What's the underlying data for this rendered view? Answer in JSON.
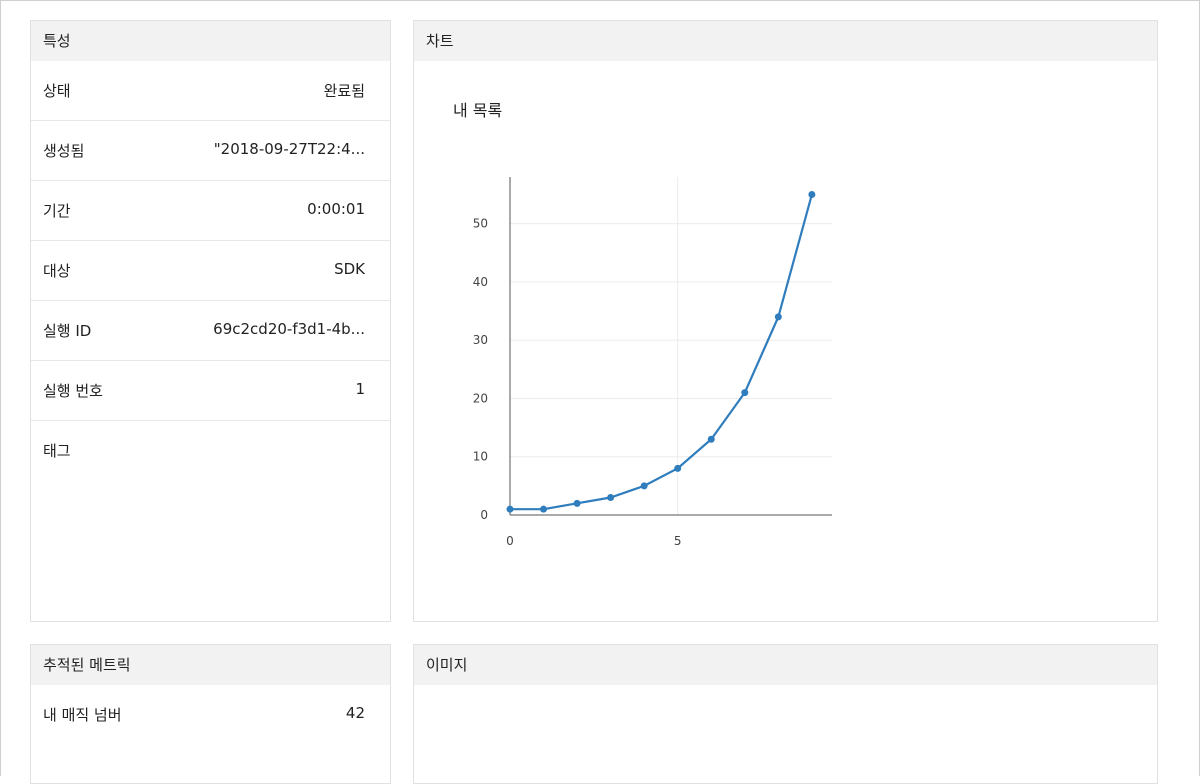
{
  "properties": {
    "header": "특성",
    "rows": [
      {
        "key": "상태",
        "value": "완료됨"
      },
      {
        "key": "생성됨",
        "value": "\"2018-09-27T22:4..."
      },
      {
        "key": "기간",
        "value": "0:00:01"
      },
      {
        "key": "대상",
        "value": "SDK"
      },
      {
        "key": "실행 ID",
        "value": "69c2cd20-f3d1-4b..."
      },
      {
        "key": "실행 번호",
        "value": "1"
      },
      {
        "key": "태그",
        "value": ""
      }
    ]
  },
  "chart_panel": {
    "header": "차트"
  },
  "chart_data": {
    "type": "line",
    "title": "내 목록",
    "xlabel": "",
    "ylabel": "",
    "x": [
      0,
      1,
      2,
      3,
      4,
      5,
      6,
      7,
      8,
      9
    ],
    "series": [
      {
        "values": [
          1,
          1,
          2,
          3,
          5,
          8,
          13,
          21,
          34,
          55
        ],
        "color": "#2f7dbd"
      }
    ],
    "xlim": [
      0,
      9.6
    ],
    "ylim": [
      0,
      58
    ],
    "xticks": [
      0,
      5
    ],
    "yticks": [
      0,
      10,
      20,
      30,
      40,
      50
    ],
    "grid": true
  },
  "metrics": {
    "header": "추적된 메트릭",
    "rows": [
      {
        "key": "내 매직 넘버",
        "value": "42"
      }
    ]
  },
  "images": {
    "header": "이미지"
  }
}
